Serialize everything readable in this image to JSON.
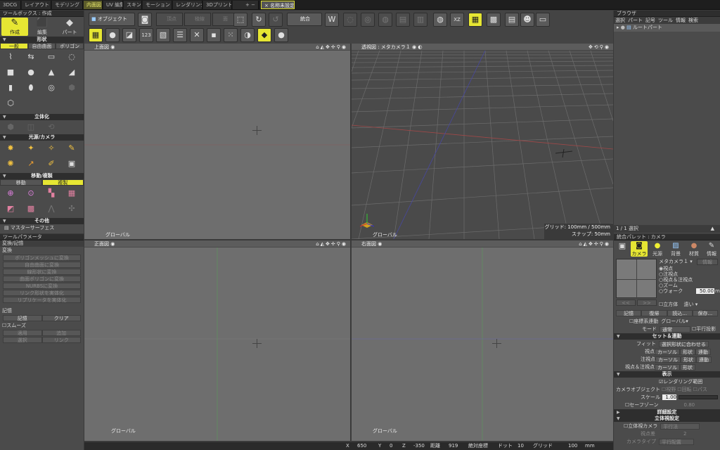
{
  "tabs": [
    "3DCG",
    "レイアウト",
    "モデリング",
    "内面図",
    "UV 編集",
    "スキン",
    "モーション",
    "レンダリング",
    "3Dプリント",
    "+ −",
    "名称未設定"
  ],
  "toolbox": {
    "title": "ツールボックス : 作成",
    "modes": [
      "作成",
      "編集",
      "パート"
    ],
    "sections": {
      "shape": "形状",
      "solid": "立体化",
      "light": "光源/カメラ",
      "move": "移動/複製",
      "other": "その他"
    },
    "shape_tabs": [
      "一般",
      "自由曲面",
      "ポリゴン"
    ],
    "move_tabs": [
      "移動",
      "複製"
    ],
    "other_item": "マスターサーフェス"
  },
  "toolparam": {
    "title": "ツールパラメータ",
    "subtitle": "変換/記憶",
    "convert_label": "変換",
    "convert_buttons": [
      "ポリゴンメッシュに変換",
      "自由曲面に変換",
      "線形状に変換",
      "曲面ポリゴンに変換",
      "NURBSに変換",
      "リンク形状を実体化",
      "リプリケータを実体化"
    ],
    "memory_label": "記憶",
    "memory_buttons": [
      "記憶",
      "クリア"
    ],
    "smooth_label": "スムーズ",
    "grid_buttons": [
      [
        "適用",
        "追加"
      ],
      [
        "選択",
        "リンク"
      ]
    ]
  },
  "toolbar": {
    "object_label": "オブジェクト",
    "point_label": "頂点",
    "edge_label": "稜線",
    "face_label": "面",
    "merge_label": "統合"
  },
  "viewports": {
    "top": {
      "title": "上面図",
      "coord": "グローバル"
    },
    "persp": {
      "title": "透視図 : メタカメラ１",
      "coord": "グローバル",
      "grid_label": "グリッド: 100mm / 500mm",
      "snap_label": "スナップ: 50mm"
    },
    "front": {
      "title": "正面図",
      "coord": "グローバル"
    },
    "right": {
      "title": "右面図",
      "coord": "グローバル"
    }
  },
  "browser": {
    "title": "ブラウザ",
    "menu": [
      "選択",
      "パート",
      "記号",
      "ツール",
      "情報",
      "検索"
    ],
    "root": "ルートパート",
    "footer": "1 / 1 選択"
  },
  "palette": {
    "title": "統合パレット : カメラ",
    "tabs": [
      "カメラ",
      "光源",
      "背景",
      "材質",
      "情報"
    ],
    "camera_name": "メタカメラ１",
    "camera_info": "情報",
    "modes": [
      "視点",
      "注視点",
      "視点＆注視点",
      "ズーム",
      "ウォーク"
    ],
    "zoom_value": "50.00",
    "zoom_unit": "m",
    "cube_label": "立方体",
    "cube_value": "遠い",
    "nav_buttons": [
      "<<",
      ">>"
    ],
    "row_buttons": [
      "記憶",
      "復帰",
      "読込...",
      "保存..."
    ],
    "coord_label": "座標系連動",
    "coord_value": "グローバル",
    "mode_label": "モード",
    "mode_value": "通常",
    "parallel_label": "平行投影",
    "set_section": "セット＆連動",
    "fit_label": "フィット",
    "fit_button": "選択形状に合わせる",
    "rows": [
      {
        "label": "視点",
        "a": "カーソル",
        "b": "形状",
        "c": "連動"
      },
      {
        "label": "注視点",
        "a": "カーソル",
        "b": "形状",
        "c": "連動"
      },
      {
        "label": "視点＆注視点",
        "a": "カーソル",
        "b": "形状",
        "c": ""
      }
    ],
    "display_section": "表示",
    "render_range": "レンダリング範囲",
    "camobj_label": "カメラオブジェクト",
    "camobj_opts": [
      "視野",
      "回転",
      "パス"
    ],
    "scale_label": "スケール",
    "scale_value": "1.00",
    "safe_label": "セーフゾーン",
    "safe_value": "0.80",
    "detail_section": "詳細設定",
    "stereo_section": "立体視設定",
    "stereo_label": "立体視カメラ",
    "stereo_value": "平行法",
    "eye_label": "視点差",
    "eye_value": "2",
    "camtype_label": "カメラタイプ",
    "camtype_value": "平行配置"
  },
  "status": {
    "x_label": "X",
    "x_value": "650",
    "y_label": "Y",
    "y_value": "0",
    "z_label": "Z",
    "z_value": "-350",
    "dist_label": "距離",
    "dist_value": "919",
    "abs_label": "絶対座標",
    "dot_label": "ドット",
    "dot_value": "10",
    "grid_label": "グリッド",
    "grid_value": "100",
    "unit": "mm"
  }
}
